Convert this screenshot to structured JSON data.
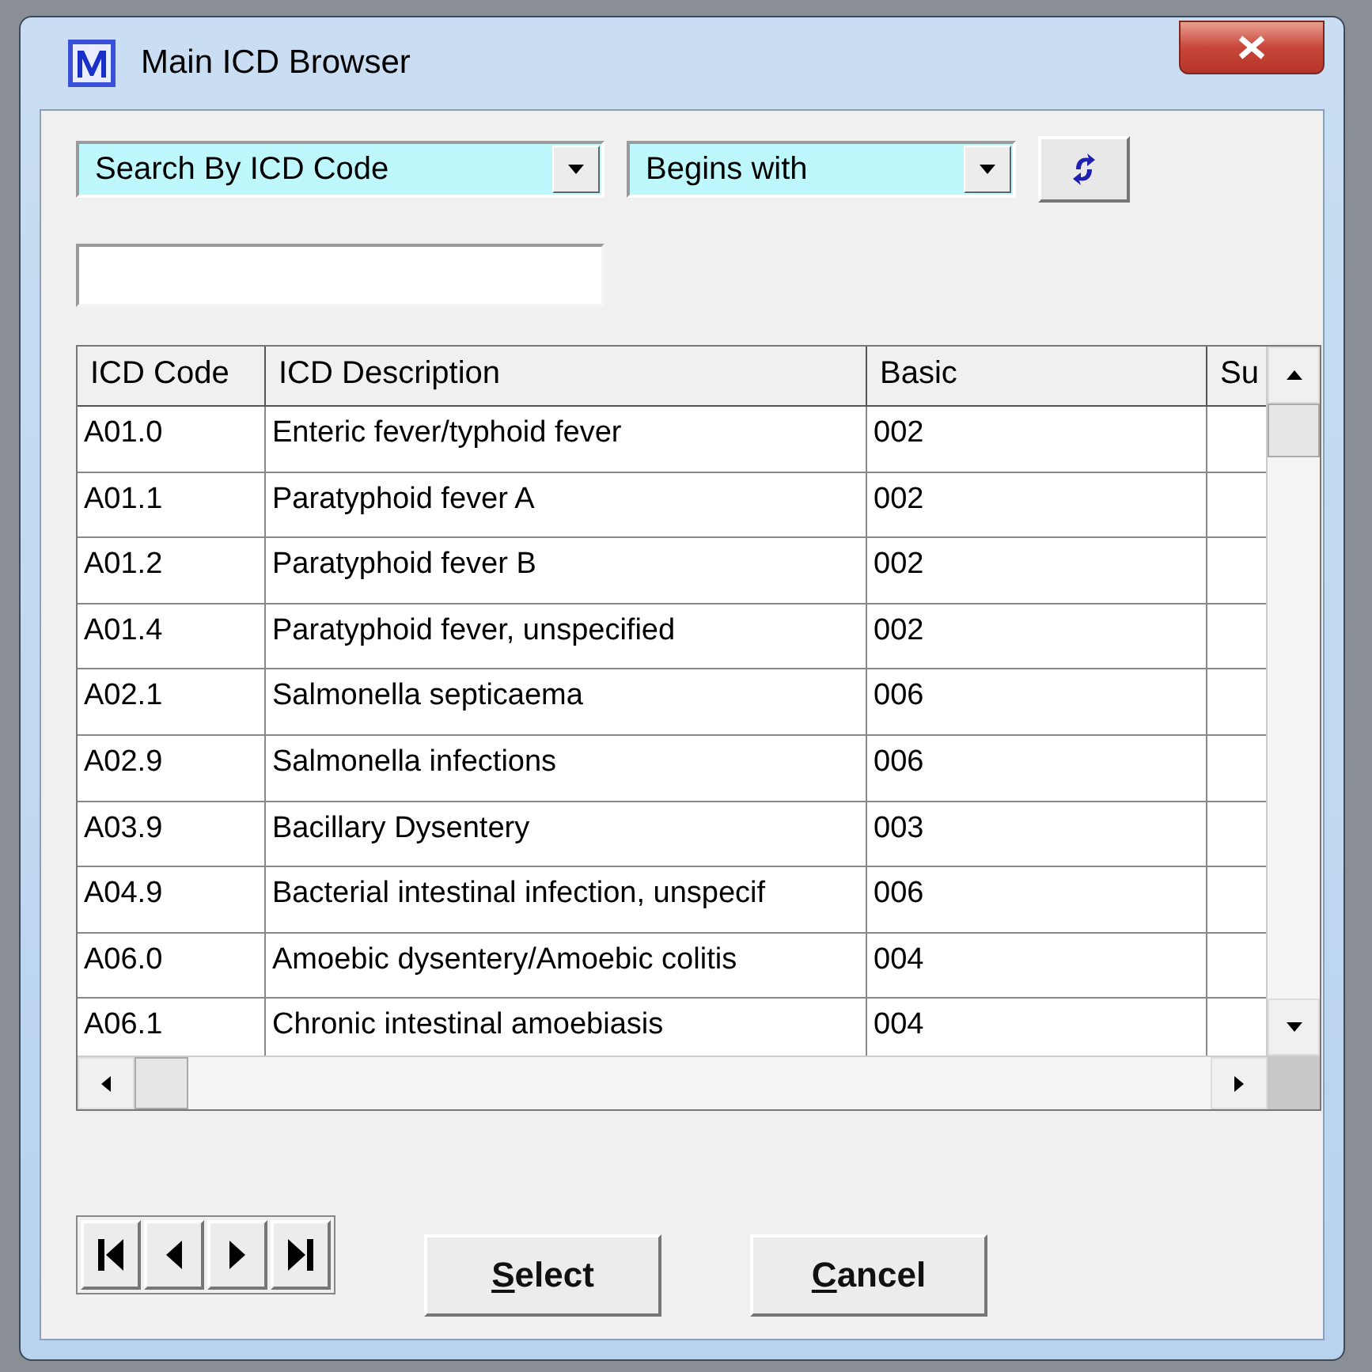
{
  "window": {
    "title": "Main ICD Browser"
  },
  "search_by": {
    "value": "Search By ICD Code"
  },
  "match_mode": {
    "value": "Begins with"
  },
  "table": {
    "columns": [
      "ICD Code",
      "ICD Description",
      "Basic",
      "Su"
    ],
    "rows": [
      {
        "cells": [
          "A01.0",
          "Enteric fever/typhoid fever",
          "002"
        ]
      },
      {
        "cells": [
          "A01.1",
          "Paratyphoid fever A",
          "002"
        ]
      },
      {
        "cells": [
          "A01.2",
          "Paratyphoid fever B",
          "002"
        ]
      },
      {
        "cells": [
          "A01.4",
          "Paratyphoid fever, unspecified",
          "002"
        ]
      },
      {
        "cells": [
          "A02.1",
          "Salmonella septicaema",
          "006"
        ]
      },
      {
        "cells": [
          "A02.9",
          "Salmonella infections",
          "006"
        ]
      },
      {
        "cells": [
          "A03.9",
          "Bacillary Dysentery",
          "003"
        ]
      },
      {
        "cells": [
          "A04.9",
          "Bacterial intestinal infection, unspecif",
          "006"
        ]
      },
      {
        "cells": [
          "A06.0",
          "Amoebic dysentery/Amoebic colitis",
          "004"
        ]
      },
      {
        "cells": [
          "A06.1",
          "Chronic intestinal amoebiasis",
          "004"
        ]
      }
    ]
  },
  "buttons": [
    {
      "label": "Select"
    },
    {
      "label": "Cancel"
    }
  ]
}
